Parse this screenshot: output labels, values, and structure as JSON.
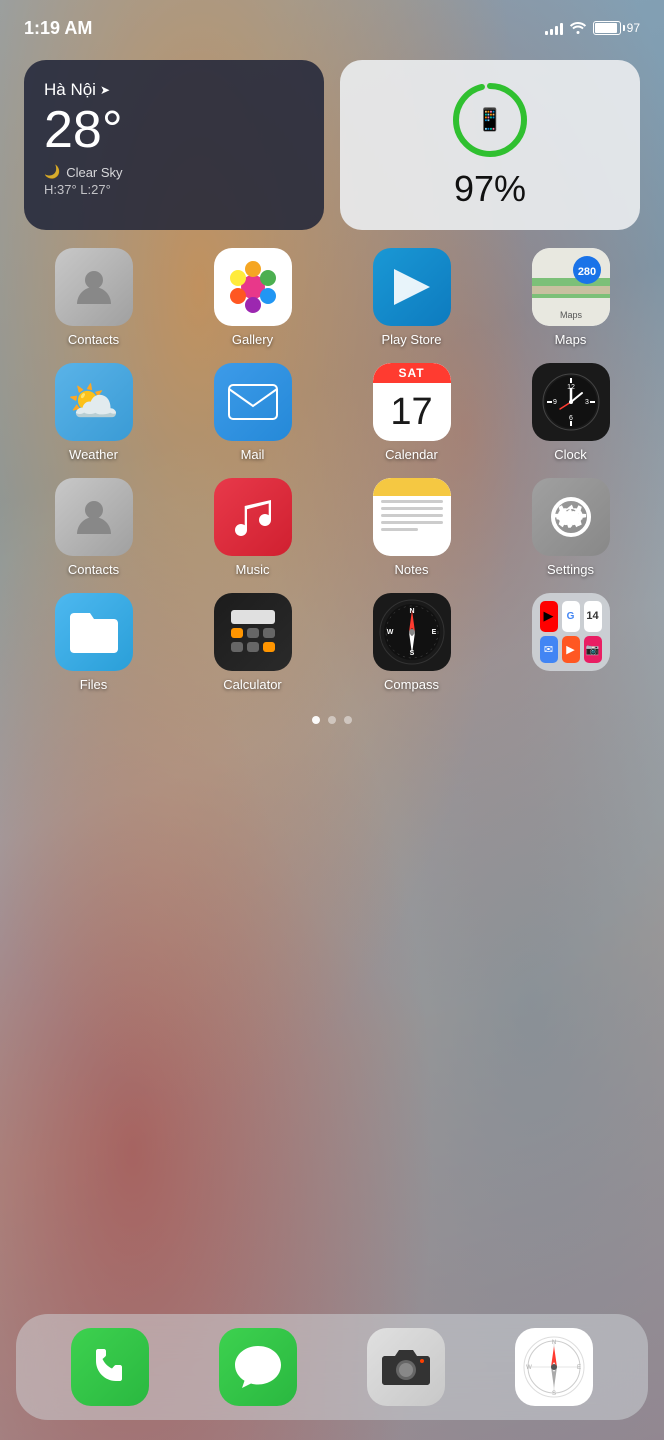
{
  "status": {
    "time": "1:19 AM",
    "battery_pct": "97",
    "battery_label": "97%"
  },
  "weather_widget": {
    "city": "Hà Nội",
    "temp": "28°",
    "condition": "Clear Sky",
    "high": "H:37°",
    "low": "L:27°"
  },
  "battery_widget": {
    "percent": "97%"
  },
  "apps": [
    {
      "id": "contacts",
      "label": "Contacts"
    },
    {
      "id": "gallery",
      "label": "Gallery"
    },
    {
      "id": "playstore",
      "label": "Play Store"
    },
    {
      "id": "maps",
      "label": "Maps"
    },
    {
      "id": "weather",
      "label": "Weather"
    },
    {
      "id": "mail",
      "label": "Mail"
    },
    {
      "id": "calendar",
      "label": "Calendar"
    },
    {
      "id": "clock",
      "label": "Clock"
    },
    {
      "id": "contacts2",
      "label": "Contacts"
    },
    {
      "id": "music",
      "label": "Music"
    },
    {
      "id": "notes",
      "label": "Notes"
    },
    {
      "id": "settings",
      "label": "Settings"
    },
    {
      "id": "files",
      "label": "Files"
    },
    {
      "id": "calculator",
      "label": "Calculator"
    },
    {
      "id": "compass",
      "label": "Compass"
    },
    {
      "id": "folder",
      "label": ""
    }
  ],
  "dock": [
    {
      "id": "phone",
      "label": "Phone"
    },
    {
      "id": "messages",
      "label": "Messages"
    },
    {
      "id": "camera",
      "label": "Camera"
    },
    {
      "id": "safari",
      "label": "Safari"
    }
  ],
  "calendar": {
    "day": "SAT",
    "date": "17"
  }
}
